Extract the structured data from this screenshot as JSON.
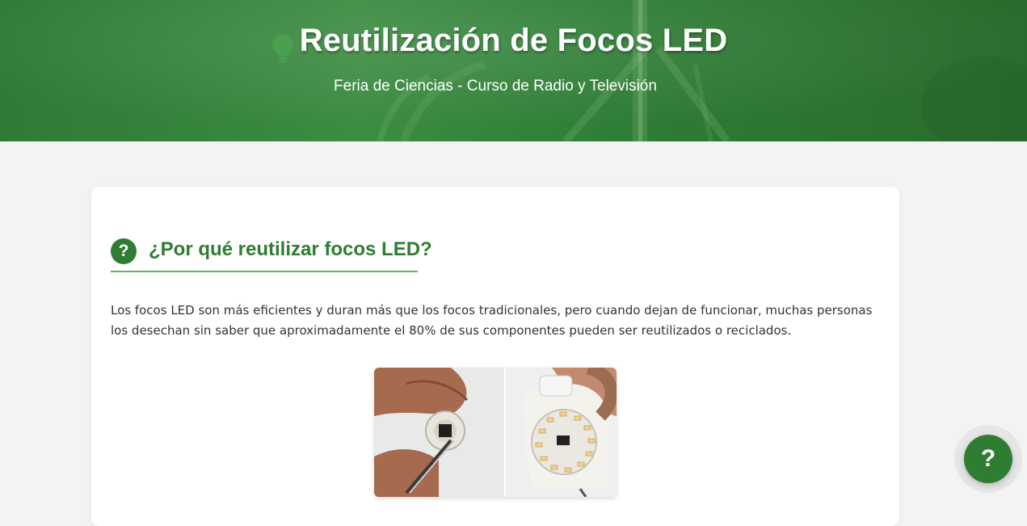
{
  "header": {
    "title": "Reutilización de Focos LED",
    "subtitle": "Feria de Ciencias - Curso de Radio y Televisión",
    "title_icon": "lightbulb-icon"
  },
  "section": {
    "icon_glyph": "?",
    "icon": "question-circle-icon",
    "title": "¿Por qué reutilizar focos LED?",
    "intro": "Los focos LED son más eficientes y duran más que los focos tradicionales, pero cuando dejan de funcionar, muchas personas los desechan sin saber que aproximadamente el 80% de sus componentes pueden ser reutilizados o reciclados."
  },
  "help_button": {
    "glyph": "?",
    "icon": "help-icon"
  },
  "colors": {
    "brand_green": "#2e7d32",
    "accent_green": "#5db862",
    "page_bg": "#f3f3f3"
  }
}
